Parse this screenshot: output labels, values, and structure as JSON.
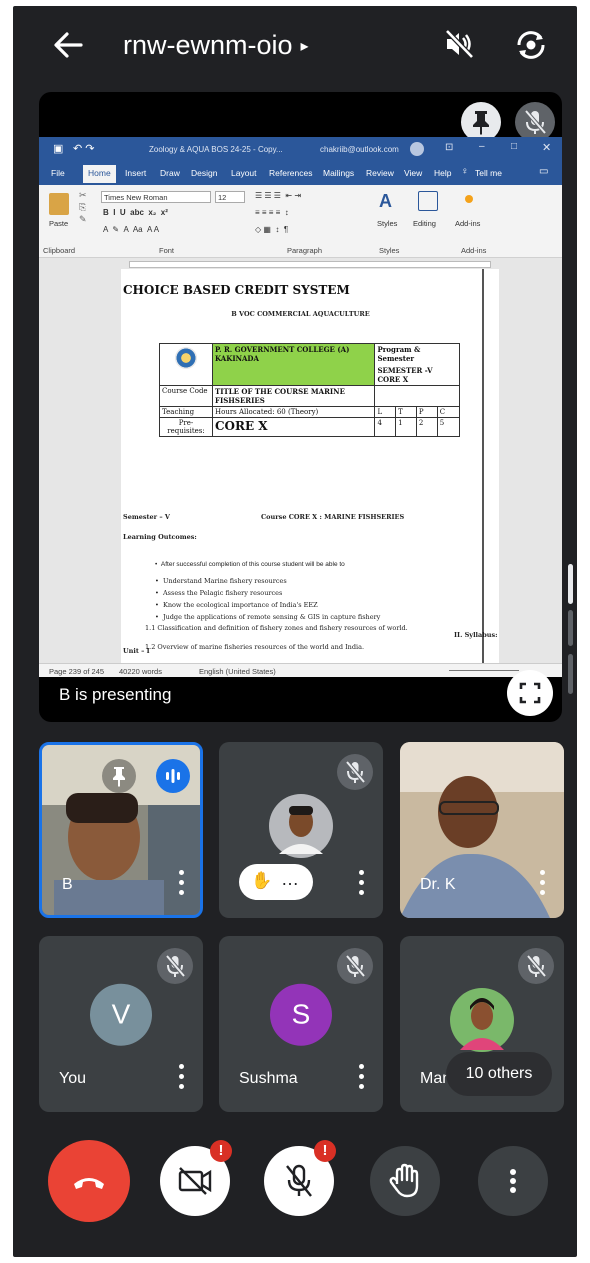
{
  "meeting": {
    "code": "rnw-ewnm-oio",
    "code_arrow": "▸"
  },
  "presentation": {
    "status": "B is presenting",
    "word": {
      "window_title": "Zoology & AQUA BOS 24-25 - Copy...",
      "account": "chakriib@outlook.com",
      "tabs": [
        "File",
        "Home",
        "Insert",
        "Draw",
        "Design",
        "Layout",
        "References",
        "Mailings",
        "Review",
        "View",
        "Help",
        "Tell me"
      ],
      "active_tab": "Home",
      "font_name": "Times New Roman",
      "font_size": "12",
      "groups": [
        "Clipboard",
        "Font",
        "Paragraph",
        "Styles",
        "Add-ins"
      ],
      "paste_label": "Paste",
      "styles_label": "Styles",
      "editing_label": "Editing",
      "addins_label": "Add-ins",
      "status": {
        "page": "Page 239 of 245",
        "words": "40220 words",
        "language": "English (United States)"
      }
    },
    "document": {
      "heading": "CHOICE BASED CREDIT SYSTEM",
      "subheading": "B VOC COMMERCIAL AQUACULTURE",
      "table": {
        "college": "P. R. GOVERNMENT COLLEGE (A) KAKINADA",
        "program_sem": "Program & Semester",
        "sem_core": "SEMESTER -V CORE X",
        "course_code_label": "Course Code",
        "course_title": "TITLE OF THE COURSE MARINE FISHSERIES",
        "teaching_label": "Teaching",
        "hours": "Hours Allocated: 60 (Theory)",
        "ltpc_head": [
          "L",
          "T",
          "P",
          "C"
        ],
        "ltpc_vals": [
          "4",
          "1",
          "2",
          "5"
        ],
        "prereq_label": "Pre-requisites:",
        "core": "CORE X"
      },
      "semester_line": "Semester – V",
      "course_line": "Course CORE X : MARINE FISHSERIES",
      "outcomes_label": "Learning Outcomes:",
      "bullets": [
        "After successful completion of this course student will be able to",
        "Understand Marine fishery resources",
        "Assess the Pelagic fishery resources",
        "Know the ecological importance of India's EEZ",
        "Judge the applications of remote sensing & GIS in capture fishery"
      ],
      "syllabus": "II. Syllabus:",
      "unit": "Unit – I",
      "items": [
        "1.1 Classification and definition of fishery zones and fishery resources of world.",
        "1.2 Overview of marine fisheries resources of the world and India."
      ]
    }
  },
  "participants": [
    {
      "name": "B",
      "muted": false
    },
    {
      "name": "",
      "raised_hand": "…",
      "muted": true
    },
    {
      "name": "Dr. K",
      "muted": false
    },
    {
      "name": "You",
      "initial": "V",
      "color": "#78909c",
      "muted": true
    },
    {
      "name": "Sushma",
      "initial": "S",
      "color": "#9334b8",
      "muted": true
    },
    {
      "name": "Mam",
      "others": "10 others",
      "muted": true
    }
  ],
  "colors": {
    "background": "#202124",
    "tile": "#3c4043",
    "end_call": "#ea4335",
    "alert": "#d93025",
    "word_blue": "#2b579a",
    "highlight": "#8fd24a"
  },
  "controls": {
    "end_call": "phone-hangup-icon",
    "camera": "camera-off-icon",
    "mic": "mic-off-icon",
    "hand": "raise-hand-icon",
    "more": "more-vert-icon",
    "alert_mark": "!"
  }
}
